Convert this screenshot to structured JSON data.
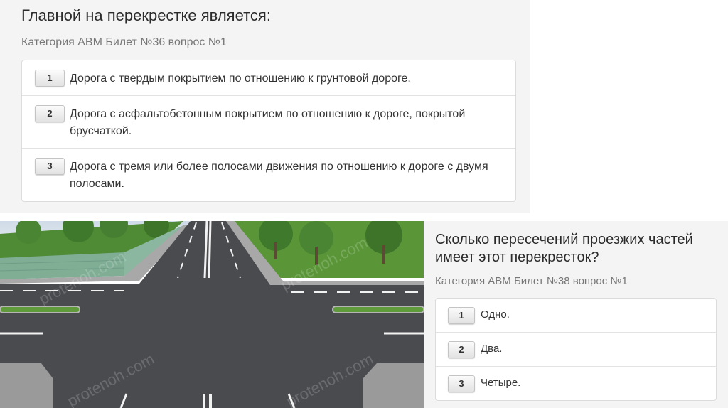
{
  "question_1": {
    "title": "Главной на перекрестке является:",
    "meta": "Категория АВМ  Билет №36  вопрос №1",
    "answers": [
      {
        "number": "1",
        "text": "Дорога с твердым покрытием по отношению к грунтовой дороге."
      },
      {
        "number": "2",
        "text": "Дорога с асфальтобетонным покрытием по отношению к дороге, покрытой брусчаткой."
      },
      {
        "number": "3",
        "text": "Дорога с тремя или более полосами движения по отношению к дороге с двумя полосами."
      }
    ]
  },
  "question_2": {
    "title": "Сколько пересечений проезжих частей имеет этот перекресток?",
    "meta": "Категория АВМ  Билет №38  вопрос №1",
    "answers": [
      {
        "number": "1",
        "text": "Одно."
      },
      {
        "number": "2",
        "text": "Два."
      },
      {
        "number": "3",
        "text": "Четыре."
      }
    ]
  },
  "image": {
    "watermark": "protenoh.com"
  },
  "colors": {
    "panel_background": "#f4f4f4",
    "asphalt": "#4a4b4f",
    "grass": "#4f8a35",
    "sky": "#d7e2ec",
    "text_primary": "#2b2b2b",
    "text_meta": "#777777"
  }
}
